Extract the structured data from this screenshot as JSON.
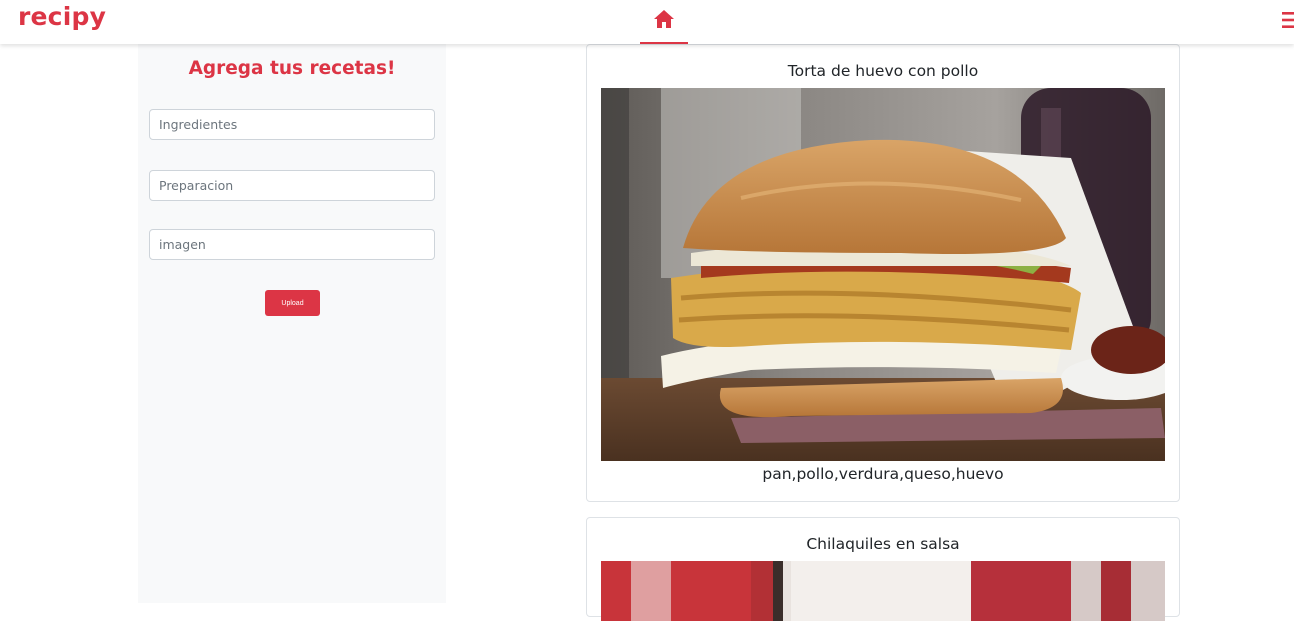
{
  "header": {
    "brand": "recipy",
    "accent_color": "#dc3545",
    "home_icon": "home-icon",
    "menu_icon": "hamburger-menu-icon"
  },
  "form": {
    "title": "Agrega tus recetas!",
    "ingredients_placeholder": "Ingredientes",
    "preparation_placeholder": "Preparacion",
    "image_placeholder": "imagen",
    "upload_label": "Upload"
  },
  "recipes": [
    {
      "title": "Torta de huevo con pollo",
      "ingredients": "pan,pollo,verdura,queso,huevo"
    },
    {
      "title": "Chilaquiles en salsa",
      "ingredients": ""
    }
  ]
}
